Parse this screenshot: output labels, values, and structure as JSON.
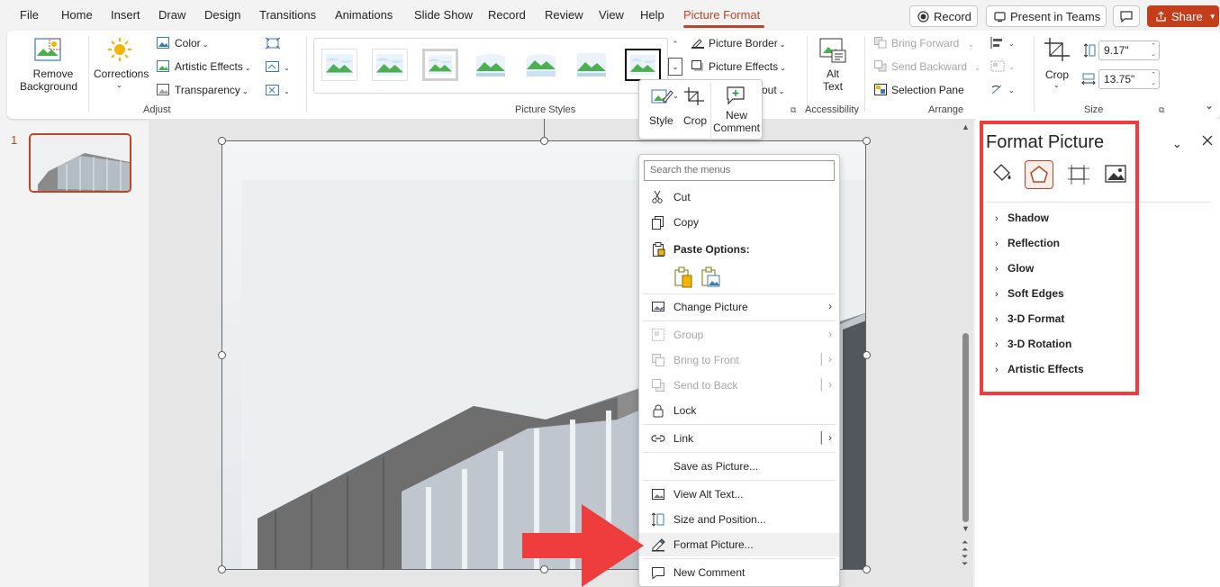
{
  "tabs": [
    "File",
    "Home",
    "Insert",
    "Draw",
    "Design",
    "Transitions",
    "Animations",
    "Slide Show",
    "Record",
    "Review",
    "View",
    "Help",
    "Picture Format"
  ],
  "active_tab": "Picture Format",
  "title_buttons": {
    "record": "Record",
    "present": "Present in Teams",
    "share": "Share"
  },
  "ribbon": {
    "remove_background": [
      "Remove",
      "Background"
    ],
    "corrections": "Corrections",
    "color": "Color",
    "artistic_effects": "Artistic Effects",
    "transparency": "Transparency",
    "adjust_label": "Adjust",
    "picture_styles_label": "Picture Styles",
    "picture_border": "Picture Border",
    "picture_effects": "Picture Effects",
    "layout_partial": "out",
    "alt_text": [
      "Alt",
      "Text"
    ],
    "accessibility_label": "Accessibility",
    "bring_forward": "Bring Forward",
    "send_backward": "Send Backward",
    "selection_pane": "Selection Pane",
    "arrange_label": "Arrange",
    "crop": "Crop",
    "height": "9.17\"",
    "width": "13.75\"",
    "size_label": "Size"
  },
  "slide_number": "1",
  "mini_toolbar": {
    "style": "Style",
    "crop": "Crop",
    "new_comment": [
      "New",
      "Comment"
    ]
  },
  "context_menu": {
    "search_placeholder": "Search the menus",
    "cut": "Cut",
    "copy": "Copy",
    "paste_options": "Paste Options:",
    "change_picture": "Change Picture",
    "group": "Group",
    "bring_to_front": "Bring to Front",
    "send_to_back": "Send to Back",
    "lock": "Lock",
    "link": "Link",
    "save_as_picture": "Save as Picture...",
    "view_alt_text": "View Alt Text...",
    "size_and_position": "Size and Position...",
    "format_picture": "Format Picture...",
    "new_comment": "New Comment"
  },
  "format_pane": {
    "title": "Format Picture",
    "sections": [
      "Shadow",
      "Reflection",
      "Glow",
      "Soft Edges",
      "3-D Format",
      "3-D Rotation",
      "Artistic Effects"
    ]
  },
  "colors": {
    "accent": "#b7472a",
    "share": "#c43e1c",
    "highlight": "#ef3d3d"
  }
}
